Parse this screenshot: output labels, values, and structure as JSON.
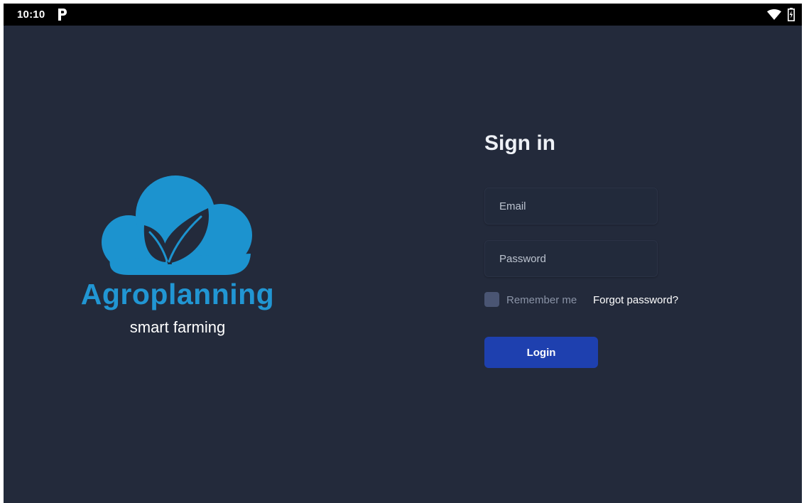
{
  "status_bar": {
    "time": "10:10",
    "icons": [
      "parking-app-icon",
      "wifi-icon",
      "battery-charging-icon"
    ]
  },
  "brand": {
    "name": "Agroplanning",
    "tagline": "smart farming",
    "cloud_color": "#1c93cf",
    "title_color": "#2196d3",
    "leaf_color": "#232a3b"
  },
  "signin": {
    "title": "Sign in",
    "email": {
      "placeholder": "Email",
      "value": ""
    },
    "password": {
      "placeholder": "Password",
      "value": ""
    },
    "remember_label": "Remember me",
    "remember_checked": false,
    "forgot_label": "Forgot password?",
    "login_label": "Login"
  },
  "colors": {
    "background": "#232a3b",
    "status_bar": "#000000",
    "accent_button": "#1e40af",
    "checkbox": "#4a5573"
  }
}
